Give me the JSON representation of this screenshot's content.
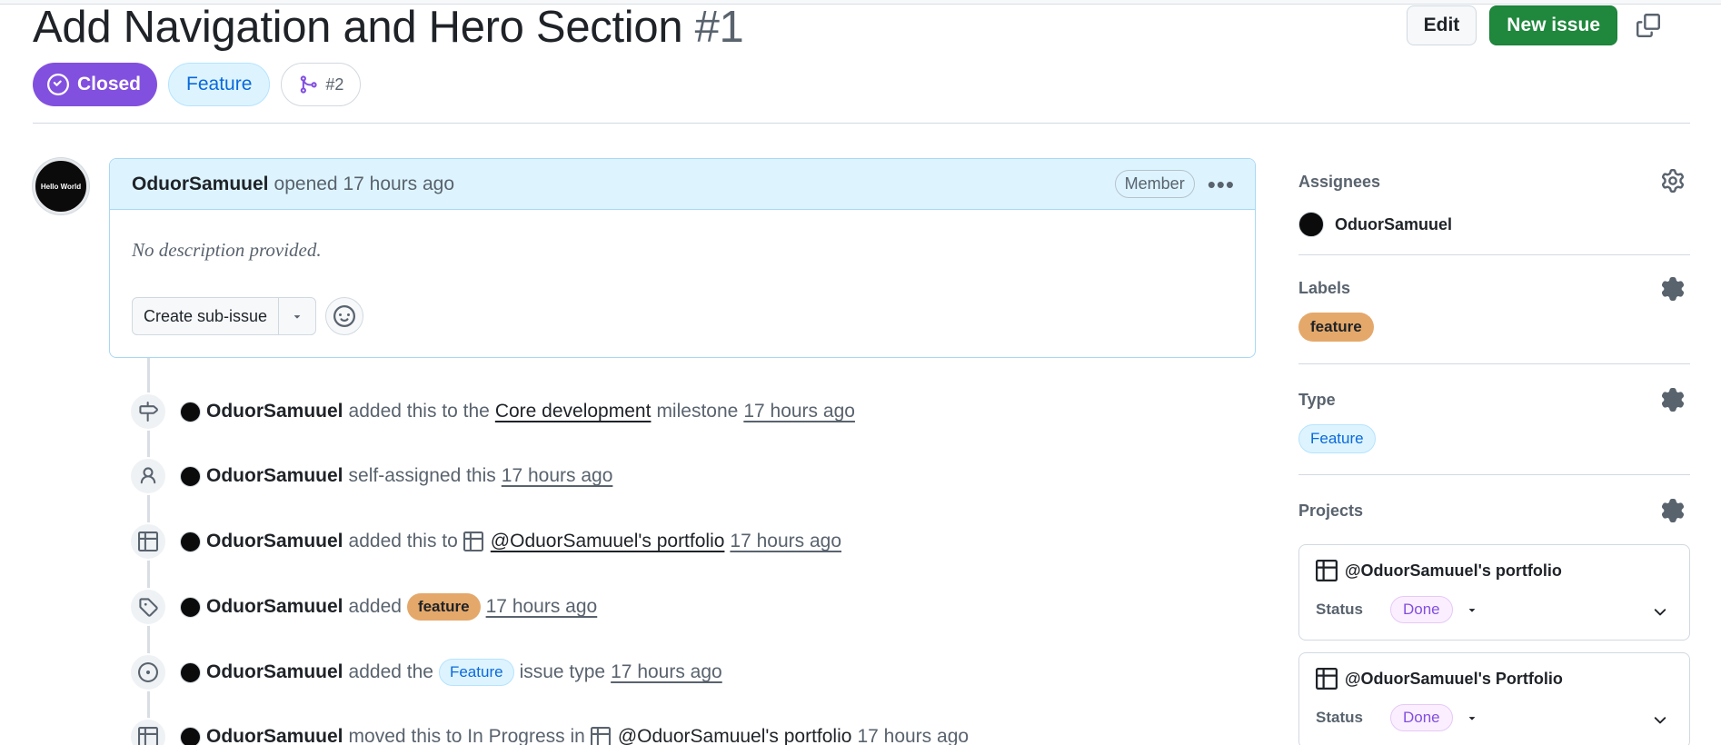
{
  "issue": {
    "title": "Add Navigation and Hero Section",
    "number": "#1",
    "state": "Closed",
    "type": "Feature",
    "linked_pr": "#2"
  },
  "header_buttons": {
    "edit": "Edit",
    "new_issue": "New issue"
  },
  "comment": {
    "avatar_text": "Hello World",
    "author": "OduorSamuuel",
    "action": "opened 17 hours ago",
    "role": "Member",
    "body": "No description provided.",
    "create_sub_issue": "Create sub-issue"
  },
  "timeline": [
    {
      "who": "OduorSamuuel",
      "t1": "added this to the",
      "link": "Core development",
      "t2": "milestone",
      "time": "17 hours ago"
    },
    {
      "who": "OduorSamuuel",
      "t1": "self-assigned this",
      "time": "17 hours ago"
    },
    {
      "who": "OduorSamuuel",
      "t1": "added this to",
      "link": "@OduorSamuuel's portfolio",
      "time": "17 hours ago"
    },
    {
      "who": "OduorSamuuel",
      "t1": "added",
      "label": "feature",
      "time": "17 hours ago"
    },
    {
      "who": "OduorSamuuel",
      "t1": "added the",
      "type": "Feature",
      "t2": "issue type",
      "time": "17 hours ago"
    },
    {
      "who": "OduorSamuuel",
      "t1": "moved this to In Progress in",
      "link": "@OduorSamuuel's portfolio",
      "time": "17 hours ago"
    }
  ],
  "sidebar": {
    "assignees_title": "Assignees",
    "assignee": "OduorSamuuel",
    "labels_title": "Labels",
    "label": "feature",
    "type_title": "Type",
    "type": "Feature",
    "projects_title": "Projects",
    "projects": [
      {
        "name": "@OduorSamuuel's portfolio",
        "status_label": "Status",
        "status": "Done"
      },
      {
        "name": "@OduorSamuuel's Portfolio",
        "status_label": "Status",
        "status": "Done"
      }
    ]
  },
  "colors": {
    "closed": "#8250df",
    "green": "#1f883d",
    "label_feature": "#e4a86a",
    "type_blue": "#0969da"
  }
}
